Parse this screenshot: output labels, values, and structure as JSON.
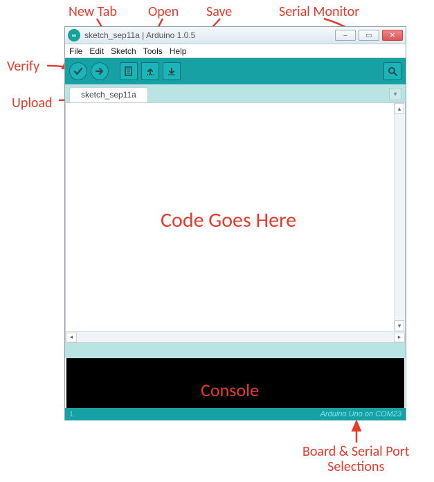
{
  "annotations": {
    "verify": "Verify",
    "upload": "Upload",
    "new_tab": "New Tab",
    "open": "Open",
    "save": "Save",
    "serial_monitor": "Serial Monitor",
    "code_goes_here": "Code Goes Here",
    "console": "Console",
    "board_serial": "Board & Serial Port\nSelections"
  },
  "window": {
    "title": "sketch_sep11a | Arduino 1.0.5",
    "app_logo_text": "∞"
  },
  "menu": {
    "file": "File",
    "edit": "Edit",
    "sketch": "Sketch",
    "tools": "Tools",
    "help": "Help"
  },
  "tabs": {
    "current": "sketch_sep11a"
  },
  "footer": {
    "line": "1",
    "board": "Arduino Uno on COM23"
  },
  "icons": {
    "verify": "verify-icon",
    "upload": "upload-icon",
    "new": "new-icon",
    "open": "open-icon",
    "save": "save-icon",
    "serial": "serial-monitor-icon",
    "tab_dropdown": "chevron-down-icon",
    "minimize": "minimize-icon",
    "maximize": "maximize-icon",
    "close": "close-icon"
  }
}
